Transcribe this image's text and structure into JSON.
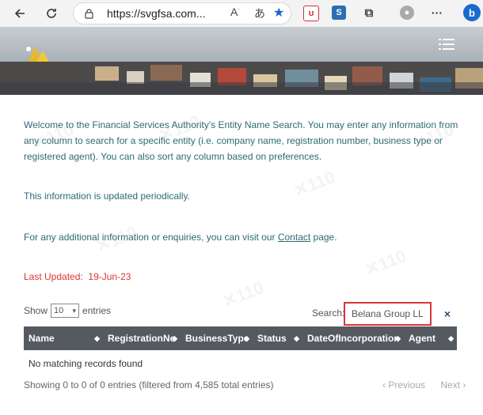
{
  "browser": {
    "url": "https://svgfsa.com...",
    "read_aloud_icon": "read-aloud-icon",
    "translate_icon": "translate-icon",
    "favorite_icon": "star-icon"
  },
  "intro": {
    "para1": "Welcome to the Financial Services Authority's Entity Name Search. You may enter any information from any column to search for a specific entity (i.e. company name, registration number, business type or registered agent). You can also sort any column based on preferences.",
    "para2": "This information is updated periodically.",
    "para3_prefix": "For any additional information or enquiries, you can visit our ",
    "para3_link": "Contact",
    "para3_suffix": " page."
  },
  "last_updated": {
    "label": "Last Updated:",
    "value": "19-Jun-23"
  },
  "table_controls": {
    "show_label": "Show",
    "entries_value": "10",
    "entries_label": "entries",
    "search_label": "Search:",
    "search_value": "Belana Group LLC",
    "clear_symbol": "×"
  },
  "table": {
    "columns": [
      "Name",
      "RegistrationNo",
      "BusinessType",
      "Status",
      "DateOfIncorporation",
      "Agent"
    ],
    "empty_message": "No matching records found"
  },
  "footer": {
    "info": "Showing 0 to 0 of 0 entries (filtered from 4,585 total entries)",
    "prev": "‹ Previous",
    "next": "Next ›"
  },
  "colors": {
    "text_teal": "#2b6a75",
    "updated_red": "#d33333",
    "header_gray": "#555a60",
    "search_border": "#d9353a"
  }
}
